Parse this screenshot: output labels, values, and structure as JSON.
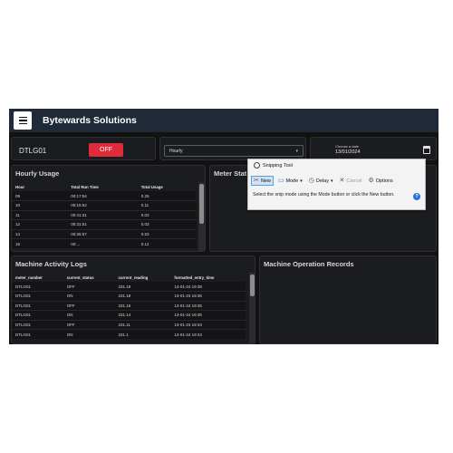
{
  "header": {
    "brand": "Bytewards Solutions",
    "menu_icon": "hamburger-icon"
  },
  "device": {
    "name": "DTLG01",
    "status_button": "OFF",
    "status_color": "#e02c3a"
  },
  "interval_select": {
    "value": "Hourly"
  },
  "date_picker": {
    "label": "Choose a date",
    "value": "13/01/2024"
  },
  "hourly_usage": {
    "title": "Hourly Usage",
    "columns": [
      "Hour",
      "Total Run Time",
      "Total Usage"
    ],
    "rows": [
      [
        "09",
        "00:17:54",
        "0.25"
      ],
      [
        "10",
        "00:16:52",
        "0.11"
      ],
      [
        "11",
        "00:41:31",
        "0.03"
      ],
      [
        "12",
        "00:31:51",
        "0.03"
      ],
      [
        "14",
        "00:26:57",
        "0.53"
      ],
      [
        "15",
        "00:...",
        "0.12"
      ]
    ]
  },
  "meter_status": {
    "title": "Meter Stat"
  },
  "activity_logs": {
    "title": "Machine Activity Logs",
    "columns": [
      "meter_number",
      "current_status",
      "current_reading",
      "formatted_entry_time"
    ],
    "rows": [
      [
        "DTLG01",
        "OFF",
        "231.19",
        "13-01-24 19:38"
      ],
      [
        "DTLG01",
        "ON",
        "231.18",
        "13-01-24 19:36"
      ],
      [
        "DTLG01",
        "OFF",
        "231.15",
        "13-01-24 19:35"
      ],
      [
        "DTLG01",
        "ON",
        "231.14",
        "13-01-24 19:35"
      ],
      [
        "DTLG01",
        "OFF",
        "231.11",
        "13-01-24 19:34"
      ],
      [
        "DTLG01",
        "ON",
        "231.1",
        "13-01-24 19:34"
      ]
    ]
  },
  "operation_records": {
    "title": "Machine Operation Records"
  },
  "snipping_tool": {
    "title": "Snipping Tool",
    "buttons": {
      "new": "New",
      "mode": "Mode",
      "delay": "Delay",
      "cancel": "Cancel",
      "options": "Options"
    },
    "message": "Select the snip mode using the Mode button or click the New button."
  }
}
